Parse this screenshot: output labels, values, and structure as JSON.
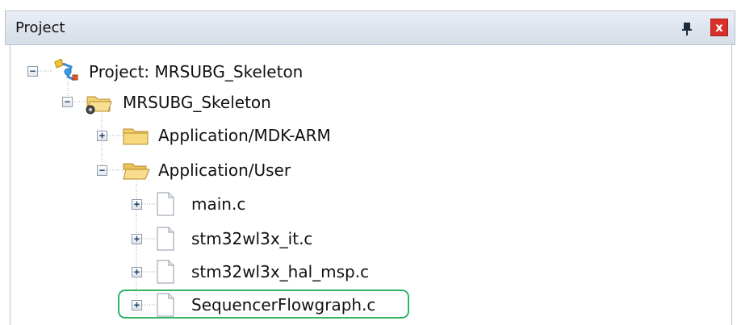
{
  "panel": {
    "title": "Project"
  },
  "tree": {
    "root_label": "Project: MRSUBG_Skeleton",
    "target_label": "MRSUBG_Skeleton",
    "group_mdk_label": "Application/MDK-ARM",
    "group_user_label": "Application/User",
    "files": [
      {
        "label": "main.c"
      },
      {
        "label": "stm32wl3x_it.c"
      },
      {
        "label": "stm32wl3x_hal_msp.c"
      },
      {
        "label": "SequencerFlowgraph.c"
      }
    ],
    "expander_collapsed": "+",
    "expander_expanded": "−"
  },
  "icons": {
    "pin": "pin-icon",
    "close": "close-icon",
    "project": "project-icon",
    "target": "target-folder-icon",
    "folder_closed": "folder-closed-icon",
    "folder_open": "folder-open-icon",
    "file": "file-icon"
  },
  "colors": {
    "close_button": "#d9302a",
    "highlight_outline": "#2fb567",
    "titlebar": "#dbe2ec"
  }
}
